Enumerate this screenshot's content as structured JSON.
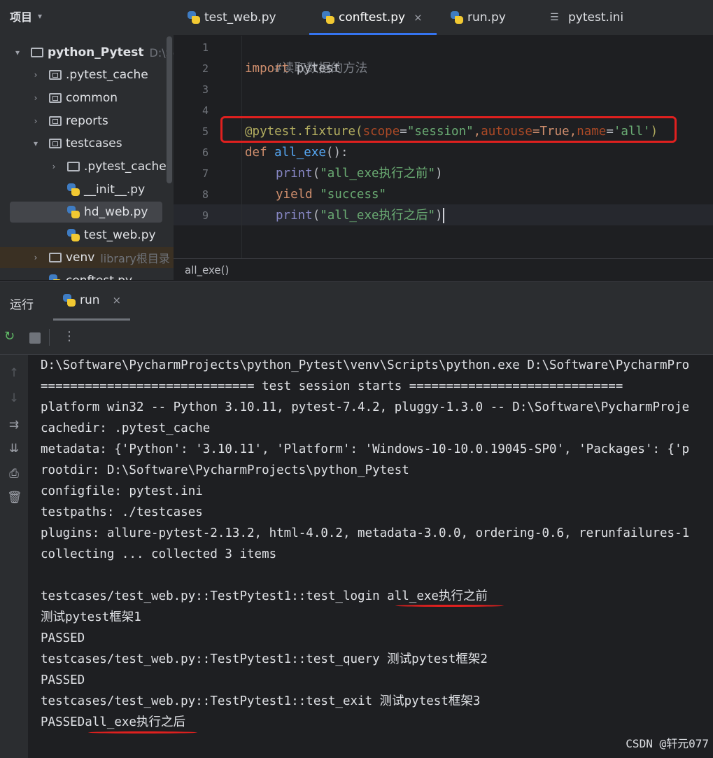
{
  "project": {
    "header": "项目",
    "tree": [
      {
        "label": "python_Pytest",
        "hint": "D:\\So",
        "type": "folder",
        "expanded": true
      },
      {
        "label": ".pytest_cache",
        "type": "folder-excluded"
      },
      {
        "label": "common",
        "type": "folder"
      },
      {
        "label": "reports",
        "type": "folder"
      },
      {
        "label": "testcases",
        "type": "folder",
        "expanded": true
      },
      {
        "label": ".pytest_cache",
        "type": "folder-excluded"
      },
      {
        "label": "__init__.py",
        "type": "py"
      },
      {
        "label": "hd_web.py",
        "type": "py",
        "selected": true
      },
      {
        "label": "test_web.py",
        "type": "py"
      },
      {
        "label": "venv",
        "hint": "library根目录",
        "type": "folder"
      },
      {
        "label": "conftest.py",
        "type": "py"
      }
    ]
  },
  "tabs": [
    {
      "label": "test_web.py",
      "icon": "python-file-icon"
    },
    {
      "label": "conftest.py",
      "icon": "python-file-icon",
      "active": true,
      "close": "×"
    },
    {
      "label": "run.py",
      "icon": "python-file-icon"
    },
    {
      "label": "pytest.ini",
      "icon": "ini-file-icon"
    }
  ],
  "editor": {
    "line_numbers": [
      "1",
      "2",
      "3",
      "4",
      "5",
      "6",
      "7",
      "8",
      "9"
    ],
    "code": {
      "l1": "#读取数据的方法",
      "l2_kw": "import",
      "l2_rest": " pytest",
      "l5_deco": "@pytest.fixture(",
      "l5_p1": "scope",
      "l5_eq1": "=",
      "l5_s1": "\"session\"",
      "l5_c1": ",",
      "l5_p2": "autouse",
      "l5_eq2": "=True",
      "l5_c2": ",",
      "l5_p3": "name",
      "l5_eq3": "=",
      "l5_s3": "'all'",
      "l5_end": ")",
      "l6_kw": "def",
      "l6_fn": " all_exe",
      "l6_end": "():",
      "l7_fn": "print",
      "l7_open": "(",
      "l7_str": "\"all_exe执行之前\"",
      "l7_close": ")",
      "l8_kw": "yield",
      "l8_str": " \"success\"",
      "l9_fn": "print",
      "l9_open": "(",
      "l9_str": "\"all_exe执行之后\"",
      "l9_close": ")"
    },
    "breadcrumb": "all_exe()"
  },
  "run_panel": {
    "title": "运行",
    "tab_label": "run",
    "tab_close": "×",
    "toolbar_more": "⋮"
  },
  "console": {
    "lines": [
      "D:\\Software\\PycharmProjects\\python_Pytest\\venv\\Scripts\\python.exe D:\\Software\\PycharmPro",
      "============================= test session starts =============================",
      "platform win32 -- Python 3.10.11, pytest-7.4.2, pluggy-1.3.0 -- D:\\Software\\PycharmProje",
      "cachedir: .pytest_cache",
      "metadata: {'Python': '3.10.11', 'Platform': 'Windows-10-10.0.19045-SP0', 'Packages': {'p",
      "rootdir: D:\\Software\\PycharmProjects\\python_Pytest",
      "configfile: pytest.ini",
      "testpaths: ./testcases",
      "plugins: allure-pytest-2.13.2, html-4.0.2, metadata-3.0.0, ordering-0.6, rerunfailures-1",
      "collecting ... collected 3 items",
      "",
      "testcases/test_web.py::TestPytest1::test_login all_exe执行之前",
      "测试pytest框架1",
      "PASSED",
      "testcases/test_web.py::TestPytest1::test_query 测试pytest框架2",
      "PASSED",
      "testcases/test_web.py::TestPytest1::test_exit 测试pytest框架3",
      "PASSEDall_exe执行之后"
    ]
  },
  "watermark": "CSDN @轩元077",
  "colors": {
    "highlight": "#e0201f",
    "accent": "#3574f0"
  }
}
